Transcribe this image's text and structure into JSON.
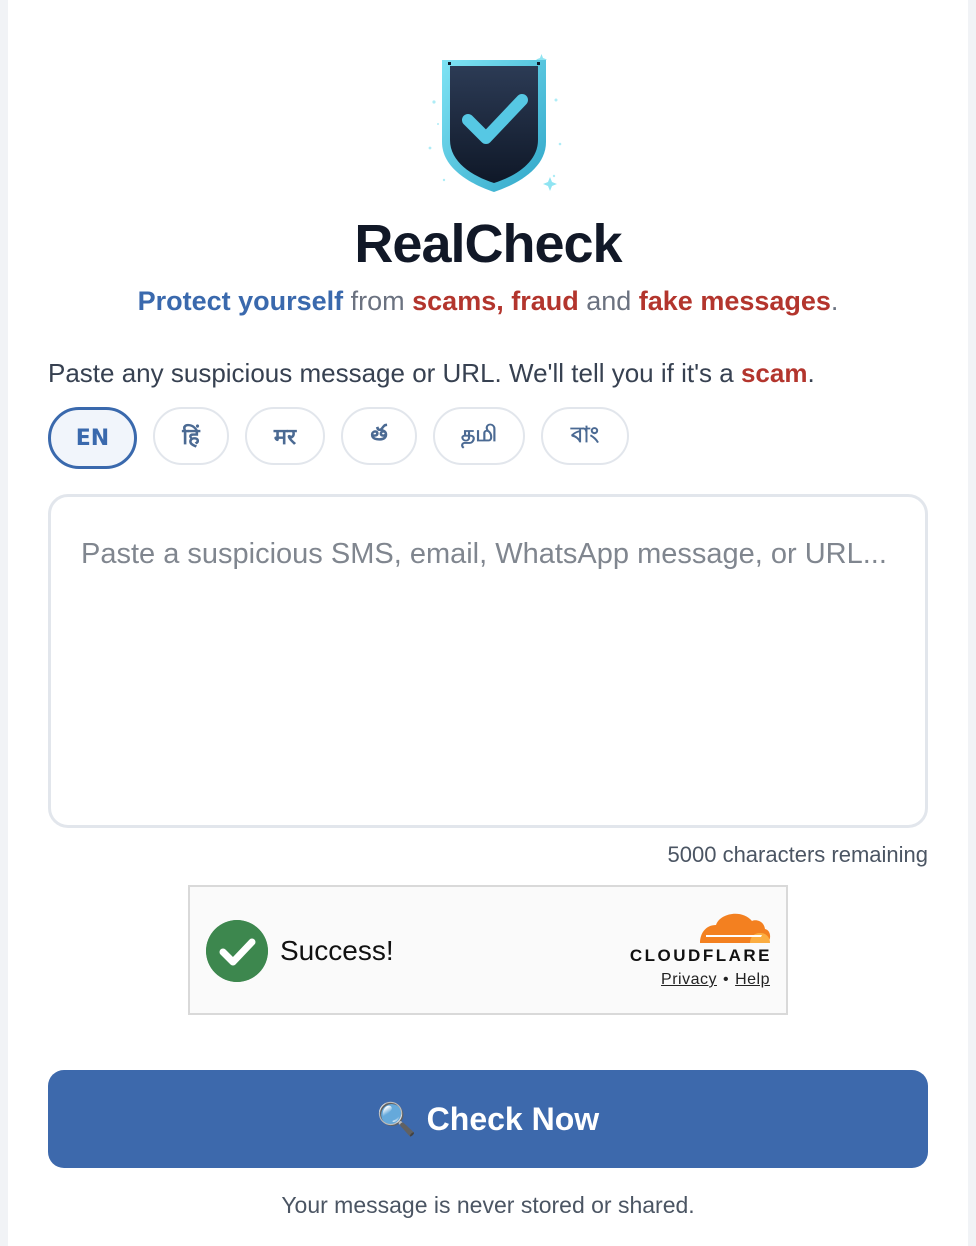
{
  "app": {
    "title": "RealCheck"
  },
  "tagline": {
    "part1": "Protect yourself",
    "part2": " from ",
    "part3": "scams, fraud",
    "part4": " and ",
    "part5": "fake messages",
    "part6": "."
  },
  "instructions": {
    "text": "Paste any suspicious message or URL. We'll tell you if it's a ",
    "highlight": "scam",
    "end": "."
  },
  "languages": [
    {
      "label": "EN",
      "active": true
    },
    {
      "label": "हिं",
      "active": false
    },
    {
      "label": "मर",
      "active": false
    },
    {
      "label": "త",
      "active": false
    },
    {
      "label": "தமி",
      "active": false
    },
    {
      "label": "বাং",
      "active": false
    }
  ],
  "message_input": {
    "placeholder": "Paste a suspicious SMS, email, WhatsApp message, or URL...",
    "value": ""
  },
  "char_counter": "5000 characters remaining",
  "captcha": {
    "status": "Success!",
    "brand": "CLOUDFLARE",
    "privacy_link": "Privacy",
    "separator": "•",
    "help_link": "Help"
  },
  "check_button": {
    "icon": "🔍",
    "label": "Check Now"
  },
  "privacy_note": "Your message is never stored or shared.",
  "colors": {
    "accent_blue": "#3d69ac",
    "accent_red": "#b3352d",
    "success_green": "#3d874e",
    "cloudflare_orange": "#f38020"
  }
}
